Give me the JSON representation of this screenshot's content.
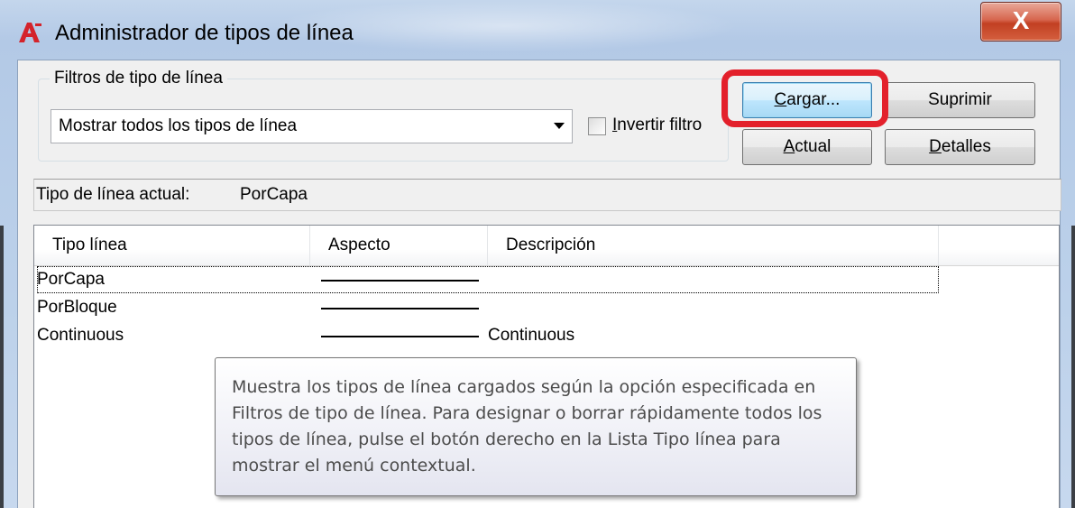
{
  "window": {
    "title": "Administrador de tipos de línea",
    "close_glyph": "X",
    "app_icon": "autocad-a-icon"
  },
  "filters": {
    "group_label": "Filtros de tipo de línea",
    "selected": "Mostrar todos los tipos de línea",
    "invert_label": "Invertir filtro",
    "invert_checked": false
  },
  "buttons": {
    "load": "Cargar...",
    "delete": "Suprimir",
    "current": "Actual",
    "details": "Detalles"
  },
  "highlight_color": "#e3202b",
  "current_linetype": {
    "label": "Tipo de línea actual:",
    "value": "PorCapa"
  },
  "list": {
    "columns": [
      "Tipo línea",
      "Aspecto",
      "Descripción"
    ],
    "rows": [
      {
        "name": "PorCapa",
        "description": ""
      },
      {
        "name": "PorBloque",
        "description": ""
      },
      {
        "name": "Continuous",
        "description": "Continuous"
      }
    ]
  },
  "tooltip": {
    "text": "Muestra los tipos de línea cargados según la opción especificada en Filtros de tipo de línea. Para designar o borrar rápidamente todos los tipos de línea, pulse el botón derecho en la Lista Tipo línea para mostrar el menú contextual."
  }
}
